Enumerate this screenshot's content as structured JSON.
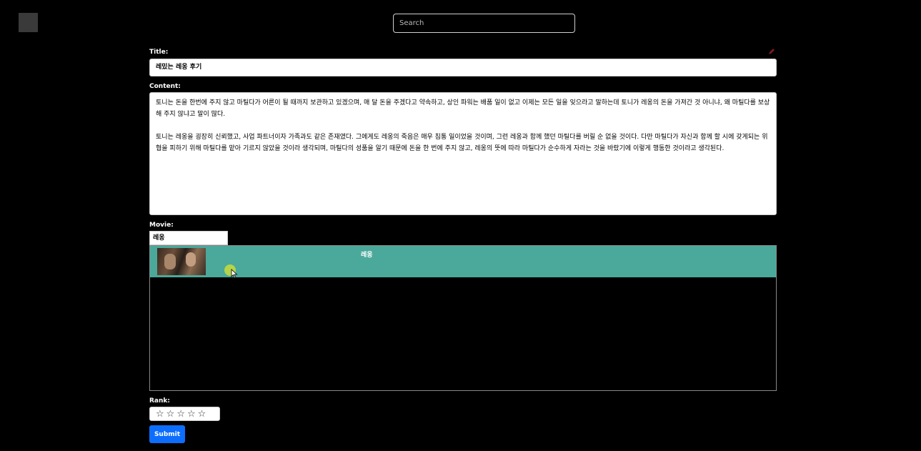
{
  "search": {
    "placeholder": "Search"
  },
  "form": {
    "title_label": "Title:",
    "title_value": "레밌는 레옹 후기",
    "content_label": "Content:",
    "content_paragraphs": [
      "토니는 돈을 한번에 주지 않고 마틸다가 어른이 될 때까지 보관하고 있겠으며, 매 달 돈을 주겠다고 약속하고, 상인 파워는 배품 일이 없고 이제는 모든 일을 잊으라고 말하는데 토니가 레옹의 돈을 가져간 것 아니냐, 왜 마틸다를 보상해 주지 않냐고 말이 많다.",
      "토니는 레옹을 굉장히 신뢰했고, 사업 파트너이자 가족과도 같은 존재였다. 그에게도 레옹의 죽음은 매우 침통 일이었을 것이며, 그런 레옹과 함께 했던 마틸다를 버릴 순 없을 것이다. 다만 마틸다가 자신과 함께 할 시에 갖게되는 위협을 피하기 위해 마틸다를 맡아 기르지 않았을 것이라 생각되며, 마틸다의 성품을 알기 때문에 돈을 한 번에 주지 않고, 레옹의 뜻에 따라 마틸다가 순수하게 자라는 것을 바랐기에 이렇게 행동한 것이라고 생각된다."
    ],
    "movie_label": "Movie:",
    "movie_value": "레옹",
    "rank_label": "Rank:",
    "stars": [
      "☆",
      "☆",
      "☆",
      "☆",
      "☆"
    ],
    "submit_label": "Submit"
  },
  "results": [
    {
      "title": "레옹"
    }
  ],
  "colors": {
    "result_highlight": "#4aa99b",
    "submit_button": "#0d6efd",
    "background": "#000000"
  }
}
